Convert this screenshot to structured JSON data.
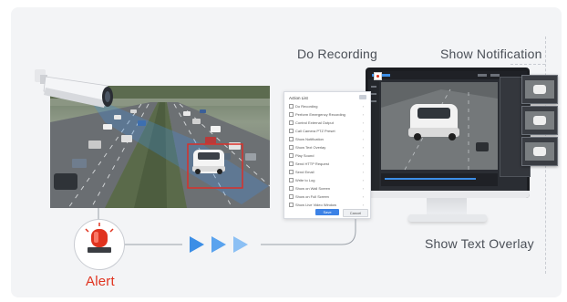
{
  "labels": {
    "do_recording": "Do Recording",
    "show_notification": "Show Notification",
    "show_text_overlay": "Show Text Overlay",
    "alert": "Alert"
  },
  "dialog": {
    "title": "Action List",
    "items": [
      "Do Recording",
      "Perform Emergency Recording",
      "Control External Output",
      "Call Camera PTZ Preset",
      "Show Notification",
      "Show Text Overlay",
      "Play Sound",
      "Send HTTP Request",
      "Send Email",
      "Write to Log",
      "Show on Wall Screen",
      "Show on Full Screen",
      "Show Live Video Window"
    ],
    "ok_label": "Save",
    "cancel_label": "Cancel"
  },
  "colors": {
    "alert_red": "#e0331f",
    "arrow_blue": "#3c8ee6",
    "detection_box": "#d9312a"
  }
}
